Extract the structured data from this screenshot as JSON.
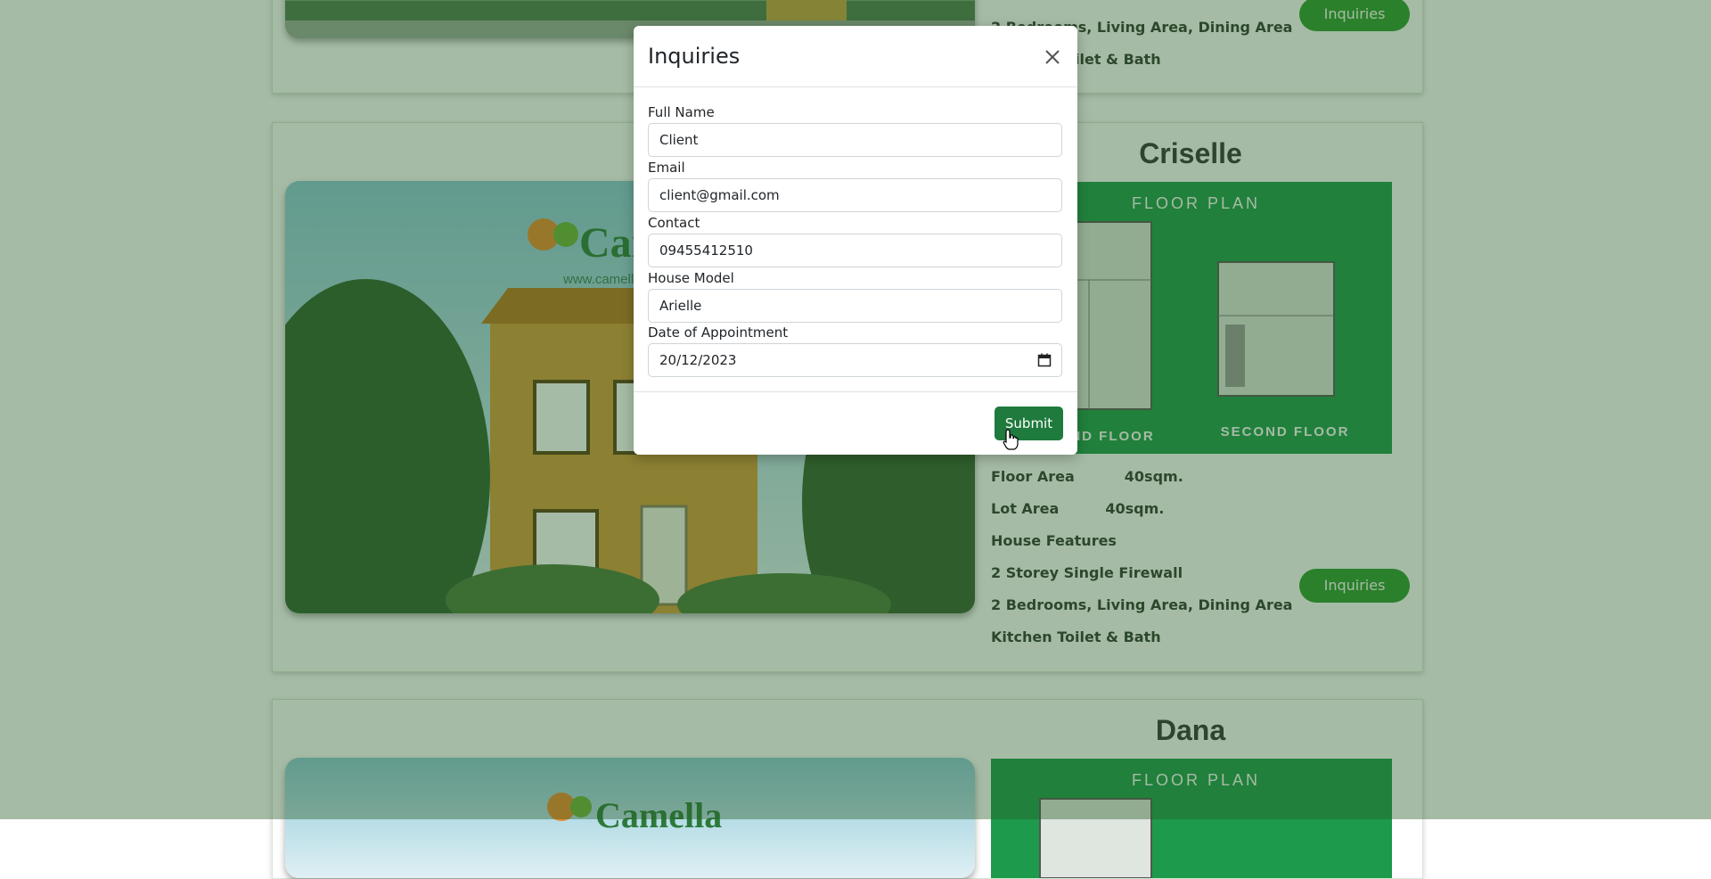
{
  "listings": [
    {
      "id": "arielle",
      "features": [
        "2 Bedrooms, Living Area, Dining Area",
        "Kitchen Toilet & Bath"
      ],
      "inquire_label": "Inquiries"
    },
    {
      "id": "criselle",
      "title": "Criselle",
      "brand_name": "Camella",
      "brand_url": "www.camella.com.ph",
      "floorplan": {
        "heading": "FLOOR PLAN",
        "ground_label": "GROUND FLOOR",
        "second_label": "SECOND FLOOR"
      },
      "floor_area_label": "Floor Area",
      "floor_area_value": "40sqm.",
      "lot_area_label": "Lot Area",
      "lot_area_value": "40sqm.",
      "features": [
        "House Features",
        "2 Storey Single Firewall",
        "2 Bedrooms, Living Area, Dining Area",
        "Kitchen Toilet & Bath"
      ],
      "inquire_label": "Inquiries"
    },
    {
      "id": "dana",
      "title": "Dana",
      "brand_name": "Camella",
      "floorplan": {
        "heading": "FLOOR PLAN"
      }
    }
  ],
  "modal": {
    "title": "Inquiries",
    "fields": {
      "full_name": {
        "label": "Full Name",
        "value": "Client"
      },
      "email": {
        "label": "Email",
        "value": "client@gmail.com"
      },
      "contact": {
        "label": "Contact",
        "value": "09455412510"
      },
      "house_model": {
        "label": "House Model",
        "value": "Arielle"
      },
      "appointment": {
        "label": "Date of Appointment",
        "value": "20/12/2023"
      }
    },
    "submit_label": "Submit"
  },
  "icons": {
    "close": "close-icon",
    "calendar": "calendar-icon",
    "cursor": "cursor-hand-icon"
  },
  "colors": {
    "overlay": "#285c28",
    "submit": "#1f7a3d",
    "inquire": "#2d9a2d",
    "floorplan_bg": "#1d9a4b"
  }
}
